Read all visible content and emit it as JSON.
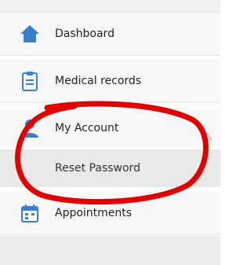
{
  "sidebar": {
    "items": [
      {
        "label": "Dashboard",
        "icon": "home-icon"
      },
      {
        "label": "Medical records",
        "icon": "clipboard-icon"
      },
      {
        "label": "My Account",
        "icon": "user-icon",
        "expanded": true,
        "children": [
          {
            "label": "Reset Password"
          }
        ]
      },
      {
        "label": "Appointments",
        "icon": "calendar-icon"
      }
    ]
  },
  "colors": {
    "icon_blue": "#3a7fcf",
    "annotation_red": "#e00000"
  }
}
